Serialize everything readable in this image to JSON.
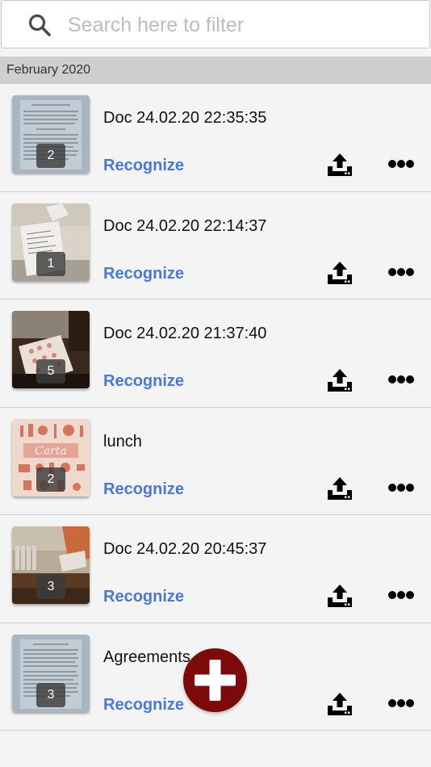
{
  "search": {
    "placeholder": "Search here to filter",
    "value": ""
  },
  "section": {
    "title": "February 2020"
  },
  "documents": [
    {
      "title": "Doc 24.02.20 22:35:35",
      "pages": "2",
      "action_label": "Recognize",
      "thumb": "document-page"
    },
    {
      "title": "Doc 24.02.20 22:14:37",
      "pages": "1",
      "action_label": "Recognize",
      "thumb": "receipt"
    },
    {
      "title": "Doc 24.02.20 21:37:40",
      "pages": "5",
      "action_label": "Recognize",
      "thumb": "menu-on-table"
    },
    {
      "title": "lunch",
      "pages": "2",
      "action_label": "Recognize",
      "thumb": "carta-menu"
    },
    {
      "title": "Doc 24.02.20 20:45:37",
      "pages": "3",
      "action_label": "Recognize",
      "thumb": "room-radiator"
    },
    {
      "title": "Agreements",
      "pages": "3",
      "action_label": "Recognize",
      "thumb": "document-page"
    }
  ],
  "icons": {
    "search": "search-icon",
    "upload": "upload-icon",
    "more": "more-icon",
    "add": "plus-icon"
  },
  "colors": {
    "accent": "#4a78d9",
    "fab": "#7d0a0a",
    "section_header": "#cfcfcf"
  }
}
